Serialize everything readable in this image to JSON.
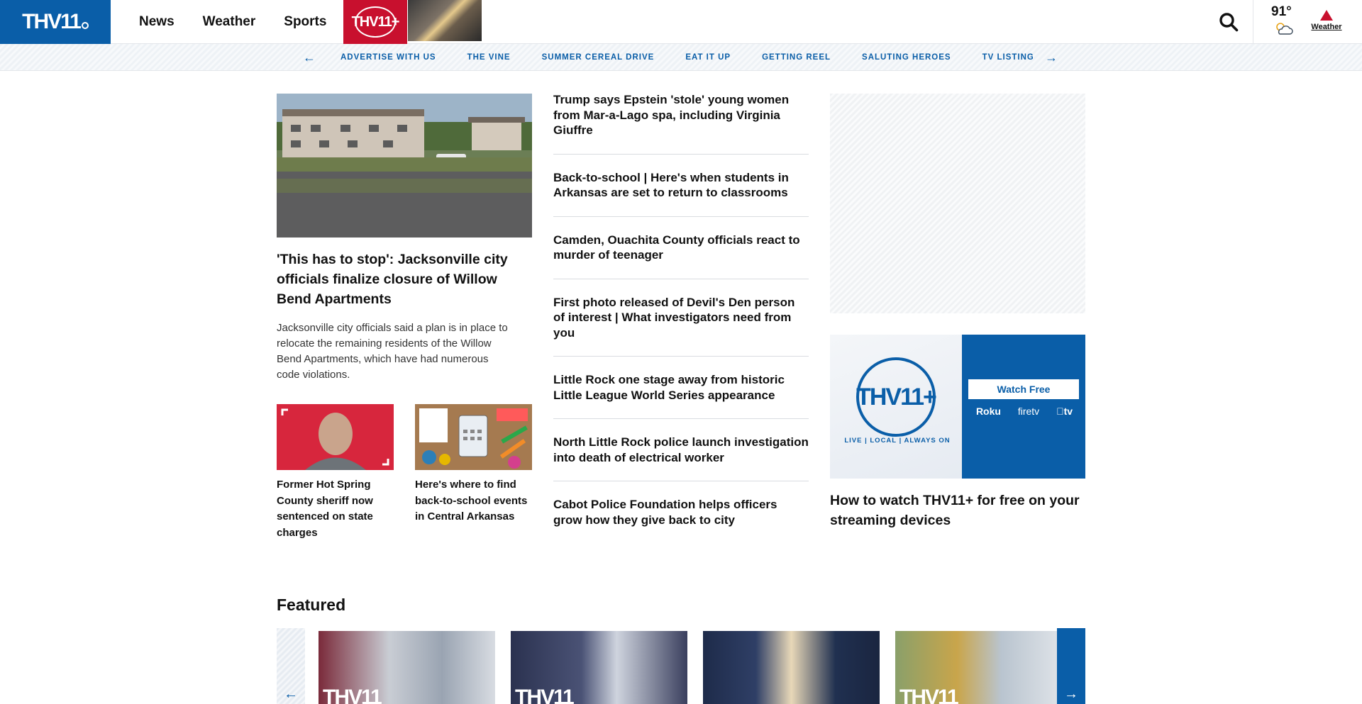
{
  "header": {
    "logo_text": "THV11",
    "nav": [
      "News",
      "Weather",
      "Sports"
    ],
    "plus_label": "THV11+",
    "temperature": "91°",
    "weather_alert_label": "Weather"
  },
  "subnav": {
    "items": [
      "ADVERTISE WITH US",
      "THE VINE",
      "SUMMER CEREAL DRIVE",
      "EAT IT UP",
      "GETTING REEL",
      "SALUTING HEROES",
      "TV LISTINGS"
    ]
  },
  "lead": {
    "title": "'This has to stop': Jacksonville city officials finalize closure of Willow Bend Apartments",
    "description": "Jacksonville city officials said a plan is in place to relocate the remaining residents of the Willow Bend Apartments, which have had numerous code violations."
  },
  "small_cards": [
    {
      "caption": "Former Hot Spring County sheriff now sentenced on state charges"
    },
    {
      "caption": "Here's where to find back-to-school events in Central Arkansas"
    }
  ],
  "headlines": [
    "Trump says Epstein 'stole' young women from Mar-a-Lago spa, including Virginia Giuffre",
    "Back-to-school | Here's when students in Arkansas are set to return to classrooms",
    "Camden, Ouachita County officials react to murder of teenager",
    "First photo released of Devil's Den person of interest | What investigators need from you",
    "Little Rock one stage away from historic Little League World Series appearance",
    "North Little Rock police launch investigation into death of electrical worker",
    "Cabot Police Foundation helps officers grow how they give back to city"
  ],
  "plus_promo": {
    "logo_text": "THV11+",
    "tagline": "LIVE | LOCAL | ALWAYS ON",
    "watch_label": "Watch Free",
    "devices": [
      "Roku",
      "firetv",
      "tv"
    ],
    "title": "How to watch THV11+ for free on your streaming devices"
  },
  "featured": {
    "heading": "Featured",
    "card_watermark": "THV11"
  },
  "colors": {
    "brand_blue": "#0a5ea8",
    "brand_red": "#c8102e"
  }
}
